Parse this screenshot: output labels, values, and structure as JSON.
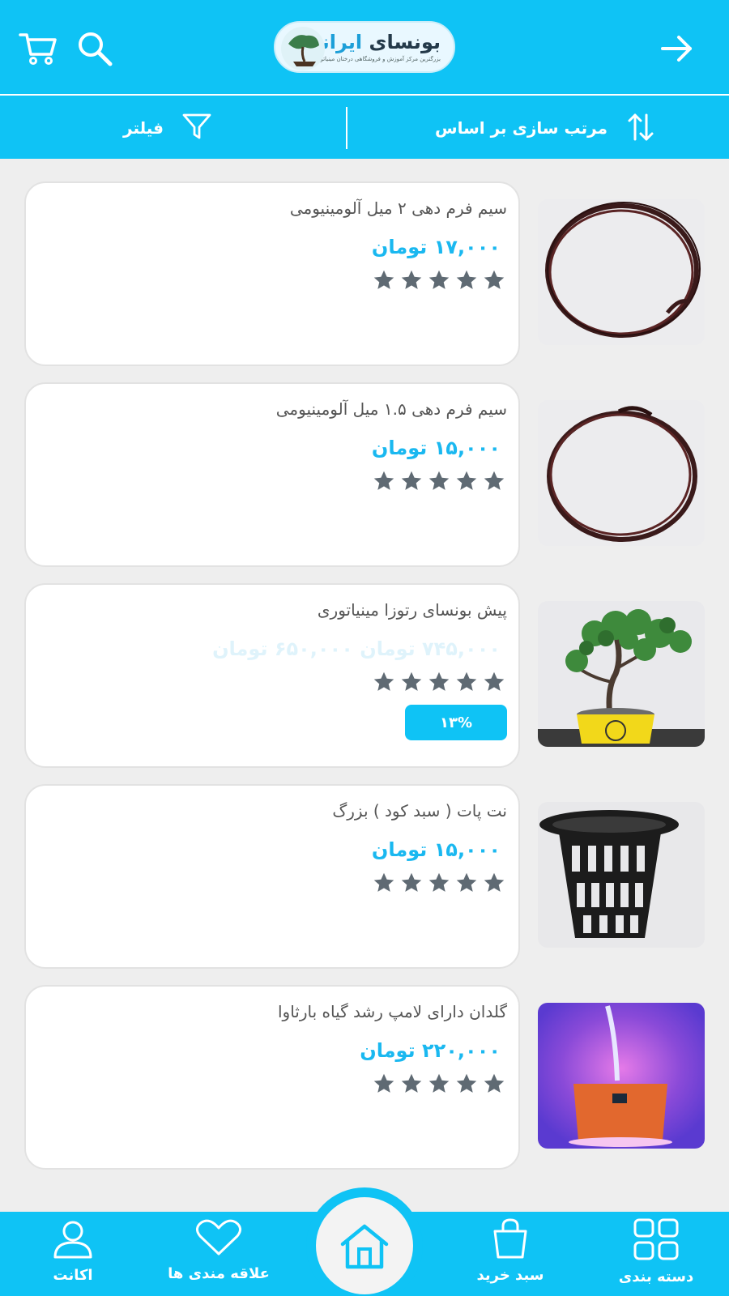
{
  "header": {
    "logo": {
      "title_part1": "بونسای",
      "title_part2": "ایرانه",
      "subtitle": "بزرگترین مرکز آموزش و فروشگاهی درختان مینیاتوری"
    },
    "icons": {
      "back": "arrow-right-icon",
      "search": "search-icon",
      "cart": "cart-icon"
    }
  },
  "toolbar": {
    "sort_label": "مرتب سازی بر اساس",
    "filter_label": "فیلتر"
  },
  "products": [
    {
      "name": "سیم فرم دهی ۲ میل آلومینیومی",
      "price": "۱۷,۰۰۰ تومان",
      "rating": 5,
      "image": "coil-wire"
    },
    {
      "name": "سیم فرم دهی ۱.۵ میل آلومینیومی",
      "price": "۱۵,۰۰۰ تومان",
      "rating": 5,
      "image": "coil-wire"
    },
    {
      "name": "پیش بونسای رتوزا مینیاتوری",
      "price": "۷۴۵,۰۰۰ تومان ۶۵۰,۰۰۰ تومان",
      "rating": 5,
      "discount": "۱۳%",
      "image": "bonsai-tree"
    },
    {
      "name": "نت پات ( سبد کود ) بزرگ",
      "price": "۱۵,۰۰۰ تومان",
      "rating": 5,
      "image": "net-pot"
    },
    {
      "name": "گلدان دارای لامپ رشد گیاه بارثاوا",
      "price": "۲۲۰,۰۰۰ تومان",
      "rating": 5,
      "image": "grow-lamp-pot"
    }
  ],
  "bottom_nav": {
    "items": [
      {
        "label": "دسته بندی",
        "icon": "grid-icon"
      },
      {
        "label": "سبد خرید",
        "icon": "shopping-bag-icon"
      },
      {
        "label": "",
        "icon": "home-icon"
      },
      {
        "label": "علاقه مندی ها",
        "icon": "heart-icon"
      },
      {
        "label": "اکانت",
        "icon": "user-icon"
      }
    ]
  },
  "colors": {
    "primary": "#0fc3f5",
    "price": "#1ab8f0",
    "star": "#5f6a73",
    "card_bg": "#ffffff",
    "page_bg": "#eeeeee"
  }
}
